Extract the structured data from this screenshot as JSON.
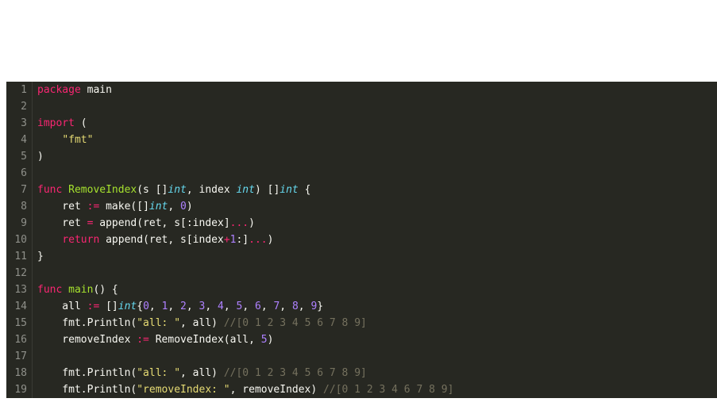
{
  "lines": [
    {
      "n": "1",
      "tokens": [
        {
          "c": "tok-kw",
          "t": "package"
        },
        {
          "c": "tok-pln",
          "t": " main"
        }
      ]
    },
    {
      "n": "2",
      "tokens": [
        {
          "c": "tok-pln",
          "t": ""
        }
      ]
    },
    {
      "n": "3",
      "tokens": [
        {
          "c": "tok-kw",
          "t": "import"
        },
        {
          "c": "tok-pln",
          "t": " ("
        }
      ]
    },
    {
      "n": "4",
      "tokens": [
        {
          "c": "tok-pln",
          "t": "    "
        },
        {
          "c": "tok-str",
          "t": "\"fmt\""
        }
      ]
    },
    {
      "n": "5",
      "tokens": [
        {
          "c": "tok-pln",
          "t": ")"
        }
      ]
    },
    {
      "n": "6",
      "tokens": [
        {
          "c": "tok-pln",
          "t": ""
        }
      ]
    },
    {
      "n": "7",
      "tokens": [
        {
          "c": "tok-kw",
          "t": "func"
        },
        {
          "c": "tok-pln",
          "t": " "
        },
        {
          "c": "tok-fn",
          "t": "RemoveIndex"
        },
        {
          "c": "tok-pln",
          "t": "(s []"
        },
        {
          "c": "tok-kw2",
          "t": "int"
        },
        {
          "c": "tok-pln",
          "t": ", index "
        },
        {
          "c": "tok-kw2",
          "t": "int"
        },
        {
          "c": "tok-pln",
          "t": ") []"
        },
        {
          "c": "tok-kw2",
          "t": "int"
        },
        {
          "c": "tok-pln",
          "t": " {"
        }
      ]
    },
    {
      "n": "8",
      "tokens": [
        {
          "c": "tok-pln",
          "t": "    ret "
        },
        {
          "c": "tok-op",
          "t": ":="
        },
        {
          "c": "tok-pln",
          "t": " make([]"
        },
        {
          "c": "tok-kw2",
          "t": "int"
        },
        {
          "c": "tok-pln",
          "t": ", "
        },
        {
          "c": "tok-num",
          "t": "0"
        },
        {
          "c": "tok-pln",
          "t": ")"
        }
      ]
    },
    {
      "n": "9",
      "tokens": [
        {
          "c": "tok-pln",
          "t": "    ret "
        },
        {
          "c": "tok-op",
          "t": "="
        },
        {
          "c": "tok-pln",
          "t": " append(ret, s[:index]"
        },
        {
          "c": "tok-op",
          "t": "..."
        },
        {
          "c": "tok-pln",
          "t": ")"
        }
      ]
    },
    {
      "n": "10",
      "tokens": [
        {
          "c": "tok-pln",
          "t": "    "
        },
        {
          "c": "tok-kw",
          "t": "return"
        },
        {
          "c": "tok-pln",
          "t": " append(ret, s[index"
        },
        {
          "c": "tok-op",
          "t": "+"
        },
        {
          "c": "tok-num",
          "t": "1"
        },
        {
          "c": "tok-pln",
          "t": ":]"
        },
        {
          "c": "tok-op",
          "t": "..."
        },
        {
          "c": "tok-pln",
          "t": ")"
        }
      ]
    },
    {
      "n": "11",
      "tokens": [
        {
          "c": "tok-pln",
          "t": "}"
        }
      ]
    },
    {
      "n": "12",
      "tokens": [
        {
          "c": "tok-pln",
          "t": ""
        }
      ]
    },
    {
      "n": "13",
      "tokens": [
        {
          "c": "tok-kw",
          "t": "func"
        },
        {
          "c": "tok-pln",
          "t": " "
        },
        {
          "c": "tok-fn",
          "t": "main"
        },
        {
          "c": "tok-pln",
          "t": "() {"
        }
      ]
    },
    {
      "n": "14",
      "tokens": [
        {
          "c": "tok-pln",
          "t": "    all "
        },
        {
          "c": "tok-op",
          "t": ":="
        },
        {
          "c": "tok-pln",
          "t": " []"
        },
        {
          "c": "tok-kw2",
          "t": "int"
        },
        {
          "c": "tok-pln",
          "t": "{"
        },
        {
          "c": "tok-num",
          "t": "0"
        },
        {
          "c": "tok-pln",
          "t": ", "
        },
        {
          "c": "tok-num",
          "t": "1"
        },
        {
          "c": "tok-pln",
          "t": ", "
        },
        {
          "c": "tok-num",
          "t": "2"
        },
        {
          "c": "tok-pln",
          "t": ", "
        },
        {
          "c": "tok-num",
          "t": "3"
        },
        {
          "c": "tok-pln",
          "t": ", "
        },
        {
          "c": "tok-num",
          "t": "4"
        },
        {
          "c": "tok-pln",
          "t": ", "
        },
        {
          "c": "tok-num",
          "t": "5"
        },
        {
          "c": "tok-pln",
          "t": ", "
        },
        {
          "c": "tok-num",
          "t": "6"
        },
        {
          "c": "tok-pln",
          "t": ", "
        },
        {
          "c": "tok-num",
          "t": "7"
        },
        {
          "c": "tok-pln",
          "t": ", "
        },
        {
          "c": "tok-num",
          "t": "8"
        },
        {
          "c": "tok-pln",
          "t": ", "
        },
        {
          "c": "tok-num",
          "t": "9"
        },
        {
          "c": "tok-pln",
          "t": "}"
        }
      ]
    },
    {
      "n": "15",
      "tokens": [
        {
          "c": "tok-pln",
          "t": "    fmt.Println("
        },
        {
          "c": "tok-str",
          "t": "\"all: \""
        },
        {
          "c": "tok-pln",
          "t": ", all) "
        },
        {
          "c": "tok-cmt",
          "t": "//[0 1 2 3 4 5 6 7 8 9]"
        }
      ]
    },
    {
      "n": "16",
      "tokens": [
        {
          "c": "tok-pln",
          "t": "    removeIndex "
        },
        {
          "c": "tok-op",
          "t": ":="
        },
        {
          "c": "tok-pln",
          "t": " RemoveIndex(all, "
        },
        {
          "c": "tok-num",
          "t": "5"
        },
        {
          "c": "tok-pln",
          "t": ")"
        }
      ]
    },
    {
      "n": "17",
      "tokens": [
        {
          "c": "tok-pln",
          "t": ""
        }
      ]
    },
    {
      "n": "18",
      "tokens": [
        {
          "c": "tok-pln",
          "t": "    fmt.Println("
        },
        {
          "c": "tok-str",
          "t": "\"all: \""
        },
        {
          "c": "tok-pln",
          "t": ", all) "
        },
        {
          "c": "tok-cmt",
          "t": "//[0 1 2 3 4 5 6 7 8 9]"
        }
      ]
    },
    {
      "n": "19",
      "tokens": [
        {
          "c": "tok-pln",
          "t": "    fmt.Println("
        },
        {
          "c": "tok-str",
          "t": "\"removeIndex: \""
        },
        {
          "c": "tok-pln",
          "t": ", removeIndex) "
        },
        {
          "c": "tok-cmt",
          "t": "//[0 1 2 3 4 6 7 8 9]"
        }
      ]
    }
  ]
}
